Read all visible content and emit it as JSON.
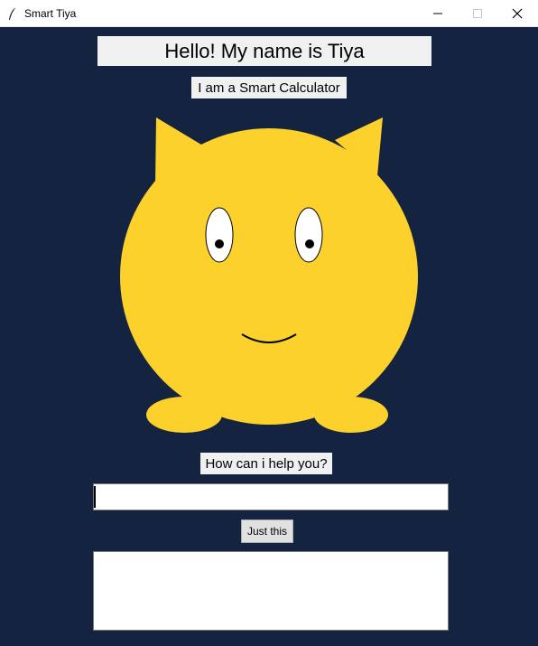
{
  "window": {
    "title": "Smart Tiya",
    "icon": "feather-icon",
    "controls": [
      "minimize-icon",
      "maximize-icon",
      "close-icon"
    ]
  },
  "main": {
    "heading": "Hello! My name is Tiya",
    "subheading": "I am a Smart Calculator",
    "question": "How can i help you?",
    "input": {
      "value": "",
      "placeholder": ""
    },
    "submit_label": "Just this",
    "answer": ""
  },
  "colors": {
    "background": "#142340",
    "mascot": "#fdd12b",
    "label_bg": "#f0f0f0"
  }
}
